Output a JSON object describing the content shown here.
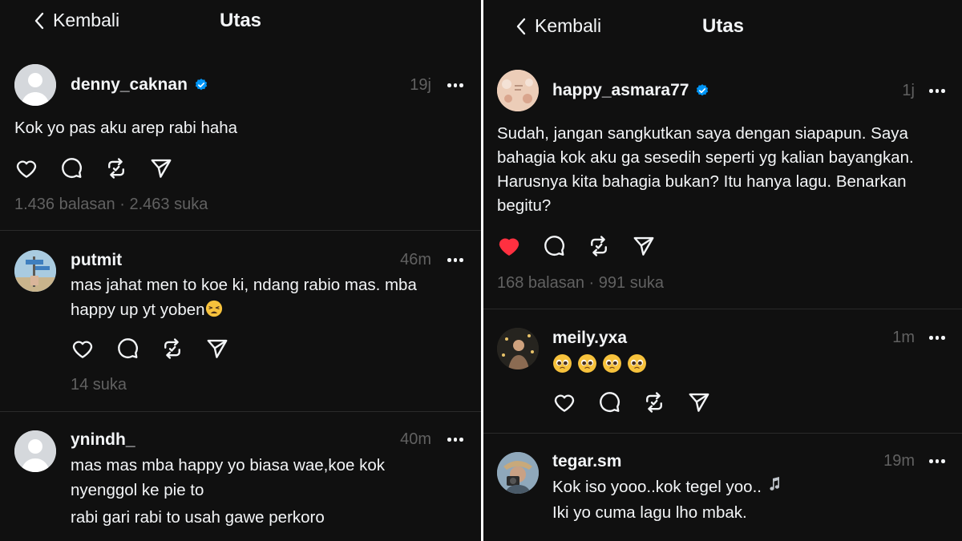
{
  "left": {
    "header": {
      "back_label": "Kembali",
      "title": "Utas"
    },
    "main_post": {
      "username": "denny_caknan",
      "time": "19j",
      "text": "Kok yo pas aku arep rabi haha",
      "replies": "1.436 balasan",
      "separator": "·",
      "likes": "2.463 suka"
    },
    "replies": [
      {
        "username": "putmit",
        "time": "46m",
        "lines": [
          "mas jahat men to koe ki, ndang rabio mas. mba",
          "happy up yt yoben"
        ],
        "stats": "14 suka"
      },
      {
        "username": "ynindh_",
        "time": "40m",
        "lines": [
          "mas mas mba happy yo biasa wae,koe kok",
          "nyenggol ke pie to",
          "rabi gari rabi to usah gawe perkoro"
        ]
      }
    ]
  },
  "right": {
    "header": {
      "back_label": "Kembali",
      "title": "Utas"
    },
    "main_post": {
      "username": "happy_asmara77",
      "time": "1j",
      "lines": [
        "Sudah, jangan sangkutkan saya dengan siapapun. Saya",
        "bahagia kok aku ga sesedih seperti yg kalian bayangkan.",
        "Harusnya kita bahagia bukan? Itu hanya lagu. Benarkan",
        "begitu?"
      ],
      "liked": true,
      "replies": "168 balasan",
      "separator": "·",
      "likes": "991 suka"
    },
    "replies": [
      {
        "username": "meily.yxa",
        "time": "1m",
        "emoji_count": 4
      },
      {
        "username": "tegar.sm",
        "time": "19m",
        "lines": [
          "Kok iso yooo..kok tegel yoo..",
          "Iki yo cuma lagu lho mbak."
        ]
      }
    ]
  },
  "icons": {
    "back": "chevron-left-icon",
    "verified": "verified-badge-icon",
    "more": "more-horizontal-icon",
    "like": "heart-icon",
    "comment": "comment-icon",
    "repost": "repost-icon",
    "share": "send-icon"
  },
  "colors": {
    "background": "#101010",
    "text": "#f3f5f7",
    "muted": "#616161",
    "verified": "#0095f6",
    "liked": "#ff3040"
  }
}
